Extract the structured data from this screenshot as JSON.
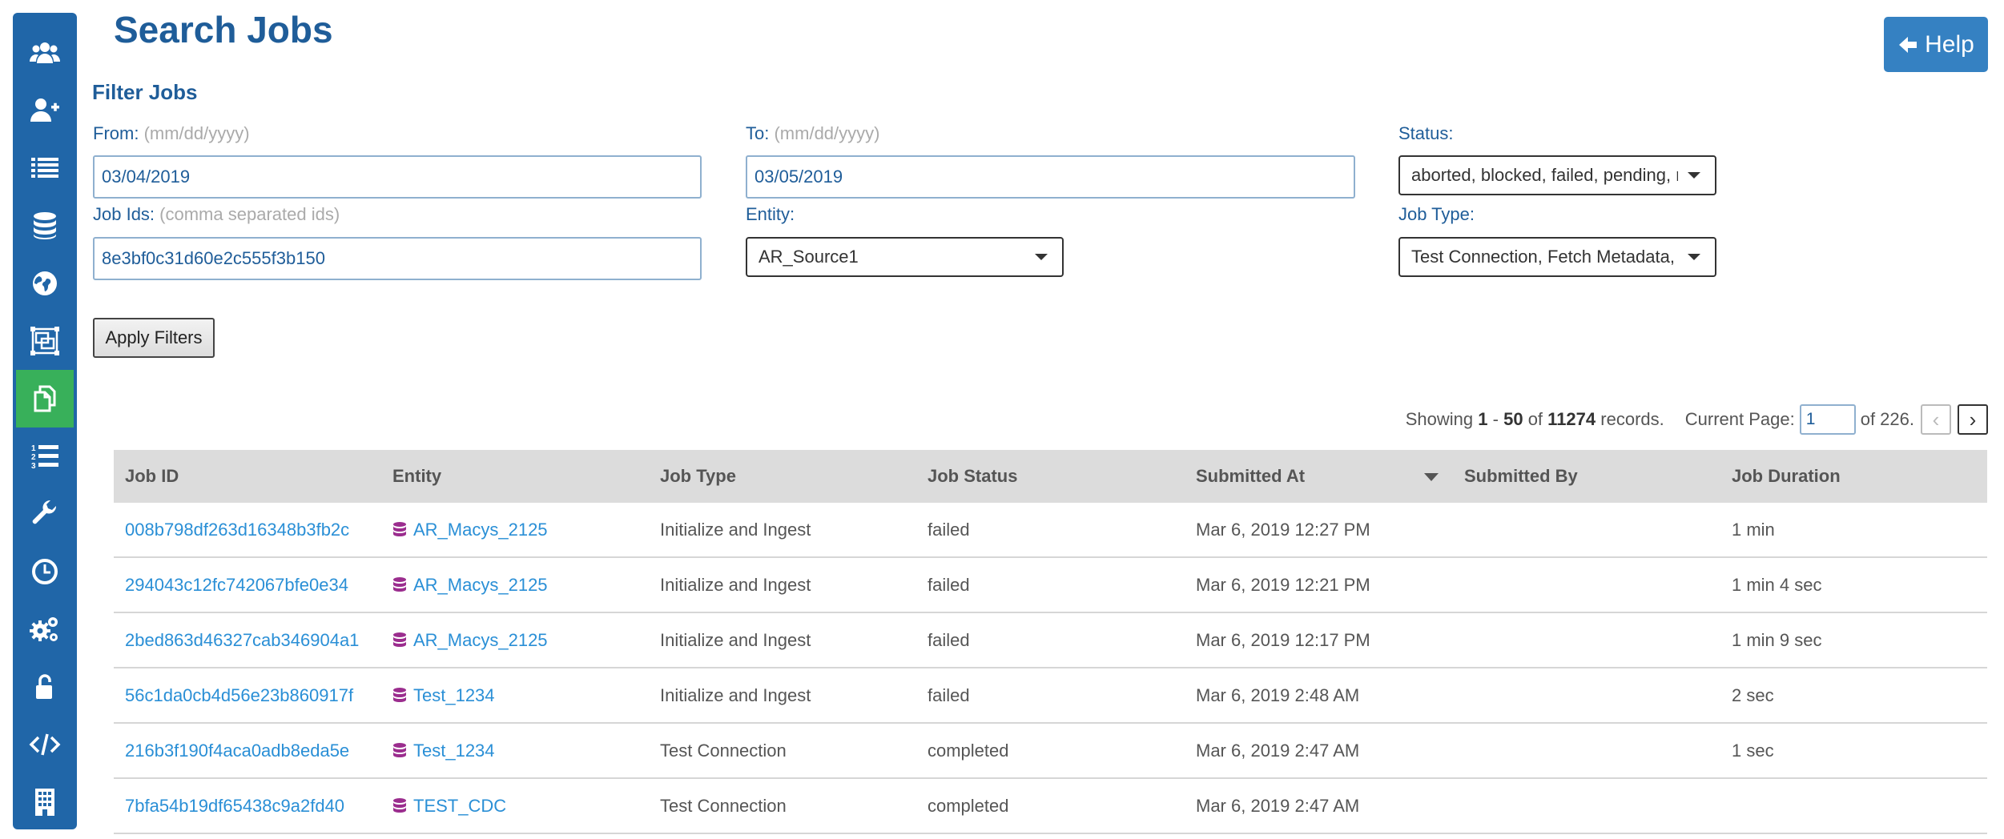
{
  "colors": {
    "sidebar_bg": "#2066a8",
    "sidebar_active": "#38b05a",
    "title": "#1f5d99",
    "link": "#2a8fd6",
    "entity_icon": "#9b2d8e",
    "help_button": "#3581c2",
    "table_header_bg": "#dcdcdc"
  },
  "sidebar": {
    "items": [
      {
        "icon": "users-icon"
      },
      {
        "icon": "add-user-icon"
      },
      {
        "icon": "list-icon"
      },
      {
        "icon": "database-icon"
      },
      {
        "icon": "globe-icon"
      },
      {
        "icon": "frames-icon"
      },
      {
        "icon": "copy-icon",
        "active": true
      },
      {
        "icon": "numbered-list-icon"
      },
      {
        "icon": "wrench-icon"
      },
      {
        "icon": "clock-icon"
      },
      {
        "icon": "gears-icon"
      },
      {
        "icon": "unlock-icon"
      },
      {
        "icon": "code-icon"
      },
      {
        "icon": "building-icon"
      }
    ]
  },
  "header": {
    "title": "Search Jobs",
    "help_label": "Help",
    "help_icon": "arrow-left-icon"
  },
  "filters": {
    "heading": "Filter Jobs",
    "from": {
      "label": "From:",
      "hint": "(mm/dd/yyyy)",
      "value": "03/04/2019"
    },
    "to": {
      "label": "To:",
      "hint": "(mm/dd/yyyy)",
      "value": "03/05/2019"
    },
    "status": {
      "label": "Status:",
      "value": "aborted, blocked, failed, pending, r"
    },
    "job_ids": {
      "label": "Job Ids:",
      "hint": "(comma separated ids)",
      "value": "8e3bf0c31d60e2c555f3b150"
    },
    "entity": {
      "label": "Entity:",
      "value": "AR_Source1"
    },
    "job_type": {
      "label": "Job Type:",
      "value": "Test Connection, Fetch Metadata, I"
    },
    "apply_label": "Apply Filters"
  },
  "pagination": {
    "showing": "Showing",
    "start": "1",
    "dash": "-",
    "end": "50",
    "of": "of",
    "total": "11274",
    "records": "records.",
    "current_page_label": "Current Page:",
    "current_page": "1",
    "of_pages": "of 226.",
    "prev_icon": "chevron-left-icon",
    "next_icon": "chevron-right-icon"
  },
  "table": {
    "columns": [
      "Job ID",
      "Entity",
      "Job Type",
      "Job Status",
      "Submitted At",
      "Submitted By",
      "Job Duration"
    ],
    "sorted_column": "Submitted At",
    "rows": [
      {
        "job_id": "008b798df263d16348b3fb2c",
        "entity": "AR_Macys_2125",
        "job_type": "Initialize and Ingest",
        "status": "failed",
        "submitted_at": "Mar 6, 2019 12:27 PM",
        "submitted_by": "",
        "duration": "1 min"
      },
      {
        "job_id": "294043c12fc742067bfe0e34",
        "entity": "AR_Macys_2125",
        "job_type": "Initialize and Ingest",
        "status": "failed",
        "submitted_at": "Mar 6, 2019 12:21 PM",
        "submitted_by": "",
        "duration": "1 min 4 sec"
      },
      {
        "job_id": "2bed863d46327cab346904a1",
        "entity": "AR_Macys_2125",
        "job_type": "Initialize and Ingest",
        "status": "failed",
        "submitted_at": "Mar 6, 2019 12:17 PM",
        "submitted_by": "",
        "duration": "1 min 9 sec"
      },
      {
        "job_id": "56c1da0cb4d56e23b860917f",
        "entity": "Test_1234",
        "job_type": "Initialize and Ingest",
        "status": "failed",
        "submitted_at": "Mar 6, 2019 2:48 AM",
        "submitted_by": "",
        "duration": "2 sec"
      },
      {
        "job_id": "216b3f190f4aca0adb8eda5e",
        "entity": "Test_1234",
        "job_type": "Test Connection",
        "status": "completed",
        "submitted_at": "Mar 6, 2019 2:47 AM",
        "submitted_by": "",
        "duration": "1 sec"
      },
      {
        "job_id": "7bfa54b19df65438c9a2fd40",
        "entity": "TEST_CDC",
        "job_type": "Test Connection",
        "status": "completed",
        "submitted_at": "Mar 6, 2019 2:47 AM",
        "submitted_by": "",
        "duration": ""
      }
    ]
  }
}
